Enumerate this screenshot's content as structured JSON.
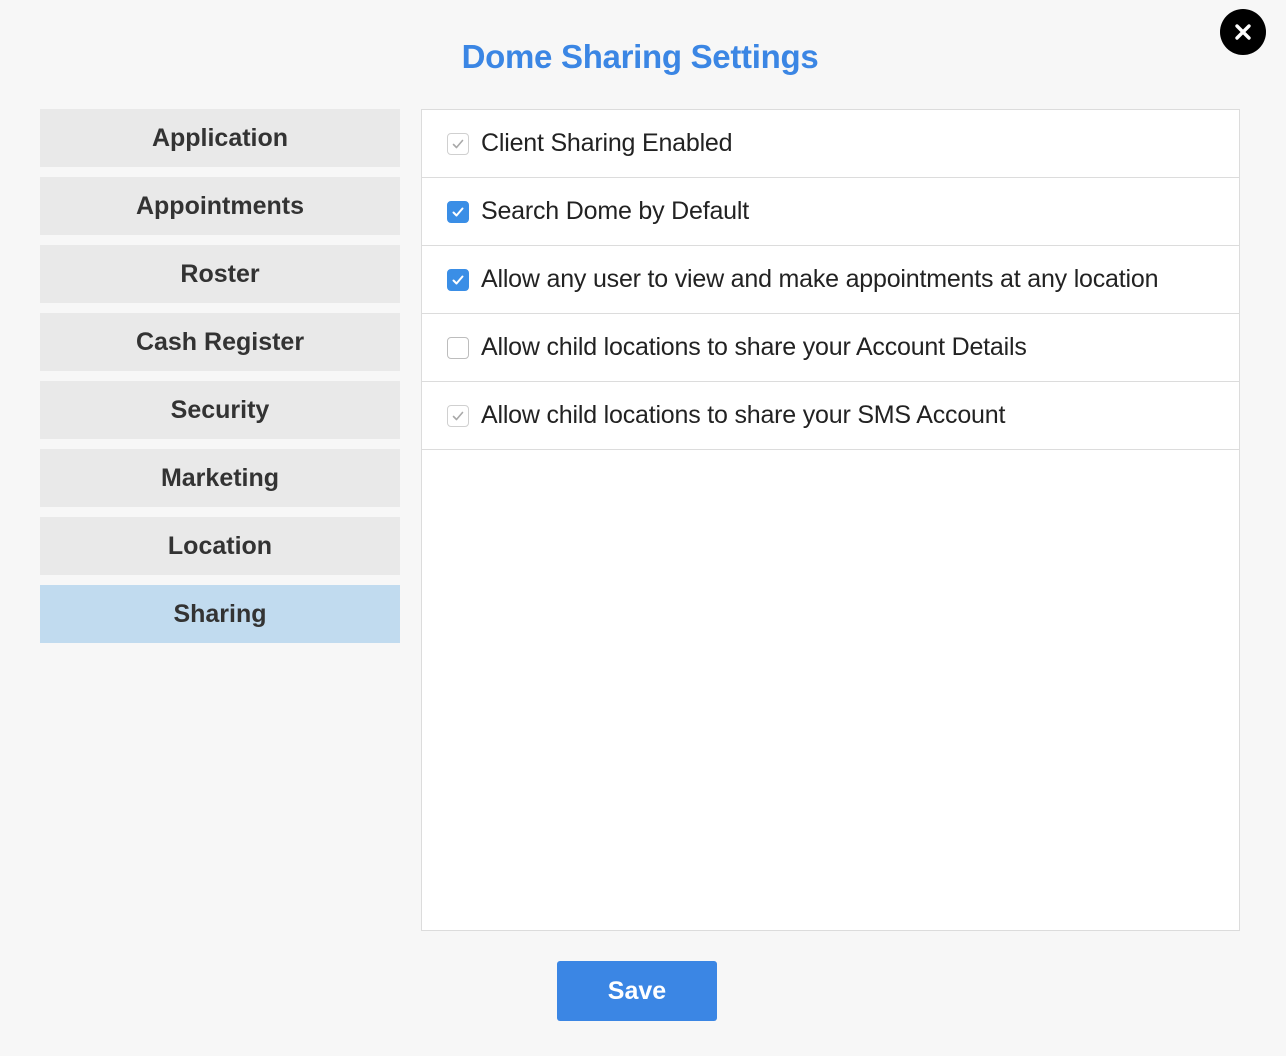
{
  "dialog": {
    "title": "Dome Sharing Settings",
    "close_icon": "close-icon"
  },
  "sidebar": {
    "items": [
      {
        "label": "Application",
        "active": false
      },
      {
        "label": "Appointments",
        "active": false
      },
      {
        "label": "Roster",
        "active": false
      },
      {
        "label": "Cash Register",
        "active": false
      },
      {
        "label": "Security",
        "active": false
      },
      {
        "label": "Marketing",
        "active": false
      },
      {
        "label": "Location",
        "active": false
      },
      {
        "label": "Sharing",
        "active": true
      }
    ]
  },
  "options": [
    {
      "label": "Client Sharing Enabled",
      "state": "checked-disabled"
    },
    {
      "label": "Search Dome by Default",
      "state": "checked"
    },
    {
      "label": "Allow any user to view and make appointments at any location",
      "state": "checked"
    },
    {
      "label": "Allow child locations to share your Account Details",
      "state": "unchecked"
    },
    {
      "label": "Allow child locations to share your SMS Account",
      "state": "checked-disabled"
    }
  ],
  "footer": {
    "save_label": "Save"
  },
  "colors": {
    "accent": "#3b86e4",
    "sidebar_active": "#c1dbef",
    "sidebar_item": "#e9e9e9",
    "background": "#f7f7f7"
  }
}
